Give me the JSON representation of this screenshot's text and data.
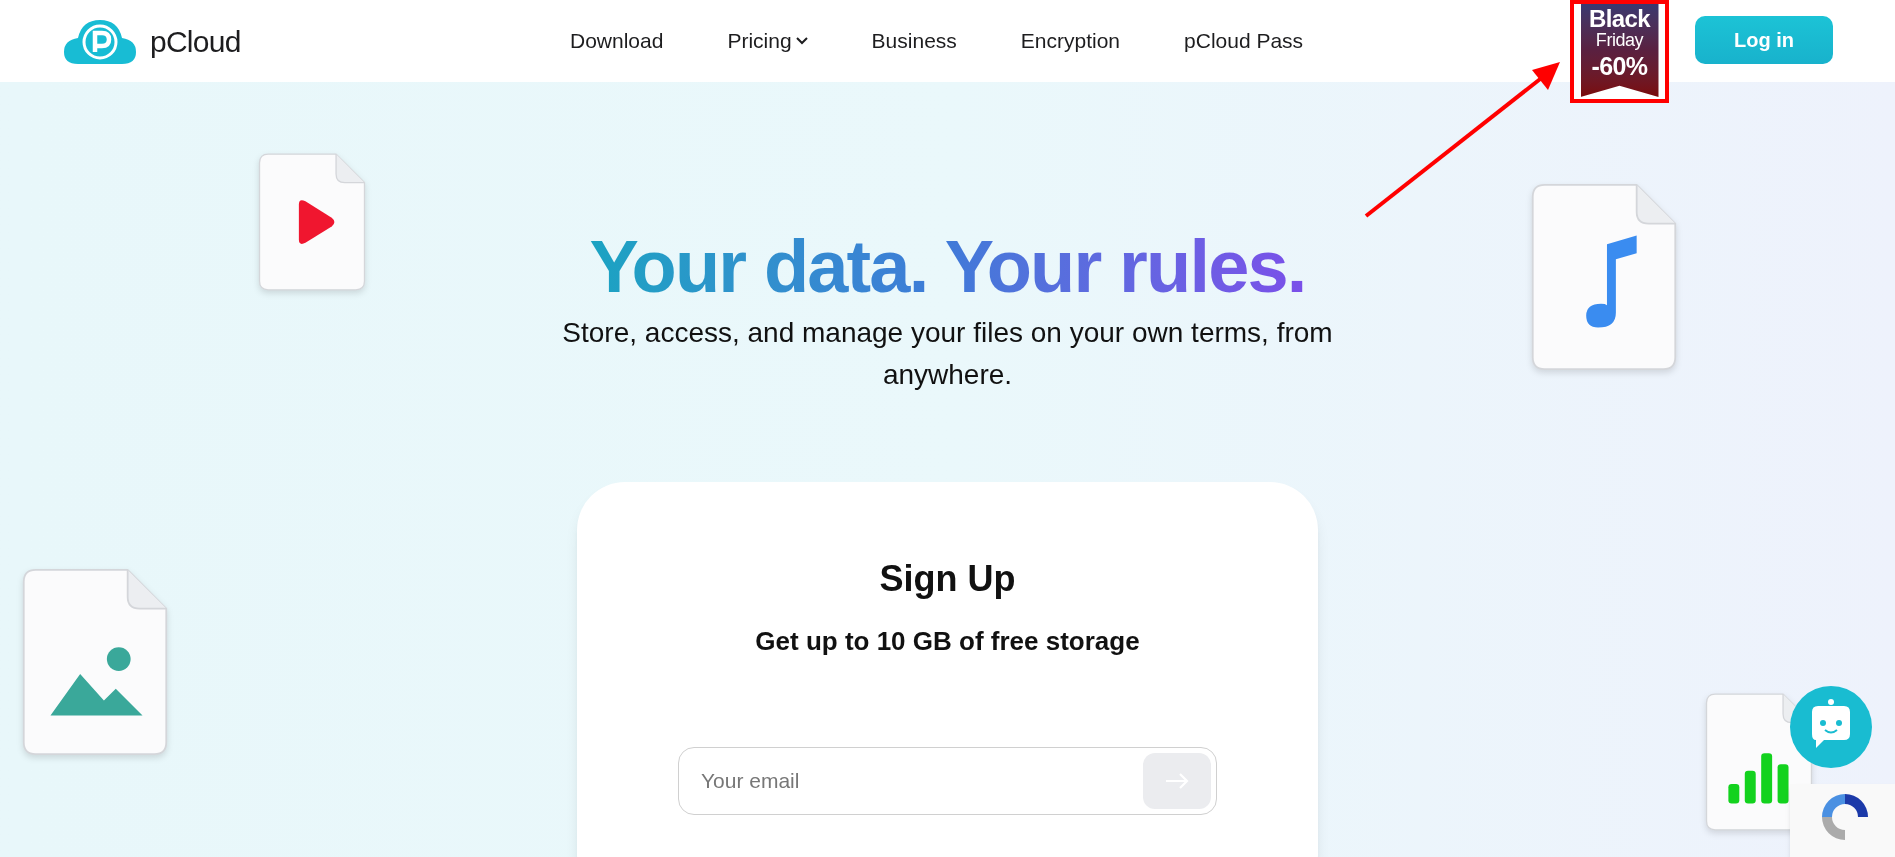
{
  "header": {
    "logo": "pCloud",
    "nav": [
      {
        "label": "Download",
        "has_menu": false
      },
      {
        "label": "Pricing",
        "has_menu": true
      },
      {
        "label": "Business",
        "has_menu": false
      },
      {
        "label": "Encryption",
        "has_menu": false
      },
      {
        "label": "pCloud Pass",
        "has_menu": false
      }
    ],
    "promo": {
      "line_1": "Black",
      "line_2": "Friday",
      "discount": "-60%"
    },
    "login_button": "Log in"
  },
  "hero": {
    "title": "Your data. Your rules.",
    "subtitle": "Store, access, and manage your files on your own terms, from anywhere."
  },
  "signup": {
    "title": "Sign Up",
    "subtitle": "Get up to 10 GB of free storage",
    "email": {
      "placeholder": "Your email"
    }
  }
}
